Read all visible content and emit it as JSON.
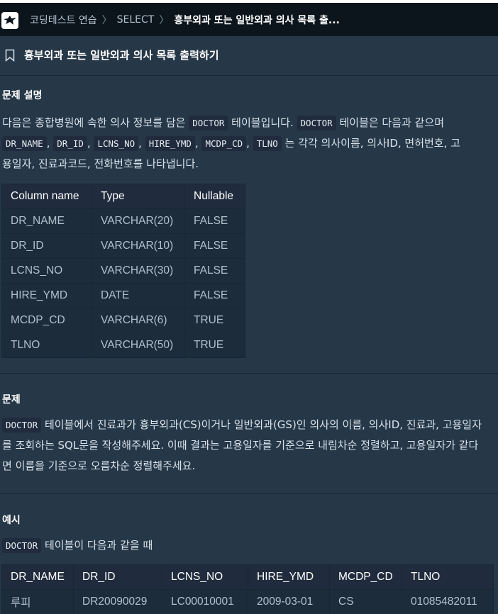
{
  "breadcrumb": {
    "items": [
      "코딩테스트 연습",
      "SELECT",
      "흥부외과 또는 일반외과 의사 목록 출..."
    ]
  },
  "problem_title": "흉부외과 또는 일반외과 의사 목록 출력하기",
  "description": {
    "heading": "문제 설명",
    "line1_a": "다음은 종합병원에 속한 의사 정보를 담은",
    "line1_code1": "DOCTOR",
    "line1_b": "테이블입니다.",
    "line1_code2": "DOCTOR",
    "line1_c": "테이블은 다음과 같으며",
    "line2_codes": [
      "DR_NAME",
      "DR_ID",
      "LCNS_NO",
      "HIRE_YMD",
      "MCDP_CD",
      "TLNO"
    ],
    "line2_sep": ",",
    "line2_tail": "는 각각 의사이름, 의사ID, 면허번호, 고",
    "line3": "용일자, 진료과코드, 전화번호를 나타냅니다."
  },
  "schema_table": {
    "headers": [
      "Column name",
      "Type",
      "Nullable"
    ],
    "rows": [
      [
        "DR_NAME",
        "VARCHAR(20)",
        "FALSE"
      ],
      [
        "DR_ID",
        "VARCHAR(10)",
        "FALSE"
      ],
      [
        "LCNS_NO",
        "VARCHAR(30)",
        "FALSE"
      ],
      [
        "HIRE_YMD",
        "DATE",
        "FALSE"
      ],
      [
        "MCDP_CD",
        "VARCHAR(6)",
        "TRUE"
      ],
      [
        "TLNO",
        "VARCHAR(50)",
        "TRUE"
      ]
    ]
  },
  "problem": {
    "heading": "문제",
    "code": "DOCTOR",
    "line1_tail": "테이블에서 진료과가 흉부외과(CS)이거나 일반외과(GS)인 의사의 이름, 의사ID, 진료과, 고용일자",
    "line2": "를 조회하는 SQL문을 작성해주세요. 이때 결과는 고용일자를 기준으로 내림차순 정렬하고, 고용일자가 같다",
    "line3": "면 이름을 기준으로 오름차순 정렬해주세요."
  },
  "example": {
    "heading": "예시",
    "code": "DOCTOR",
    "text": "테이블이 다음과 같을 때",
    "headers": [
      "DR_NAME",
      "DR_ID",
      "LCNS_NO",
      "HIRE_YMD",
      "MCDP_CD",
      "TLNO"
    ],
    "rows": [
      [
        "루피",
        "DR20090029",
        "LC00010001",
        "2009-03-01",
        "CS",
        "01085482011"
      ]
    ]
  },
  "colors": {
    "background": "#263747",
    "topbar": "#0c151c",
    "code_bg": "#202b3d"
  },
  "icons": [
    "logo-icon",
    "chevron-right-icon",
    "bookmark-icon"
  ]
}
